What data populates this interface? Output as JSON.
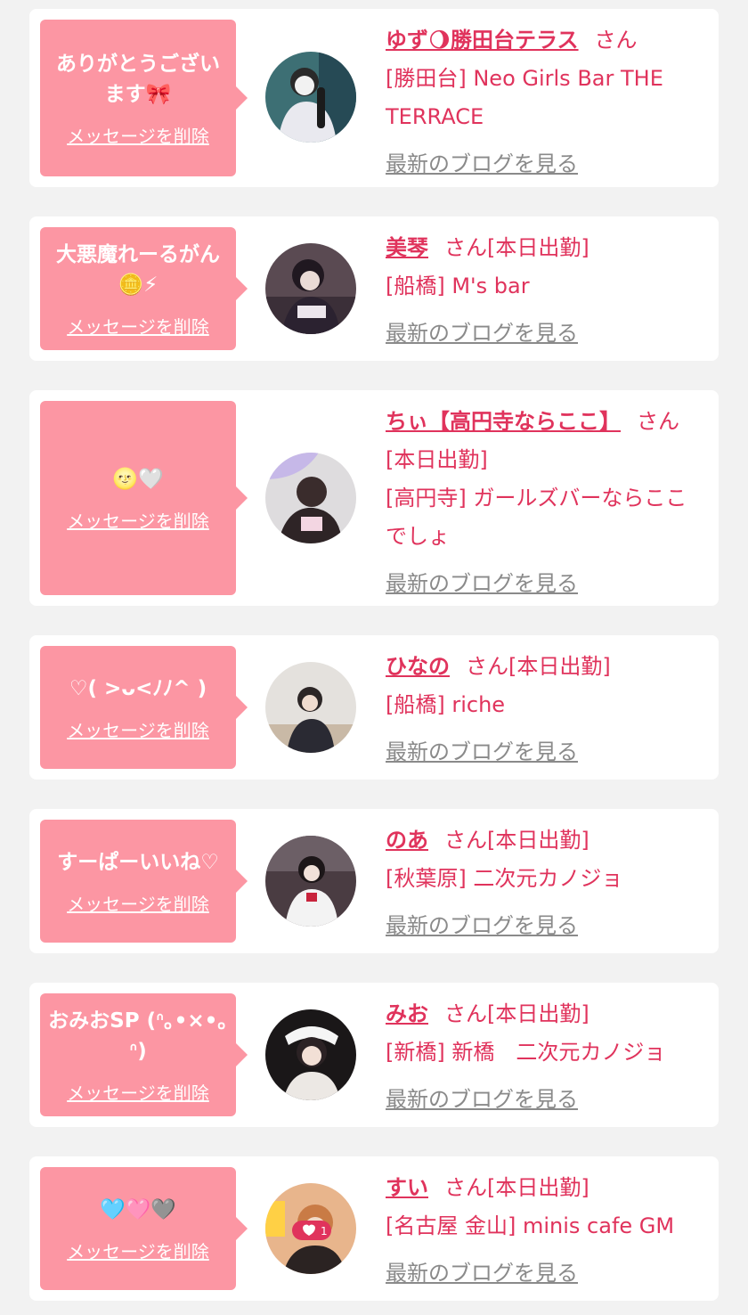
{
  "delete_label": "メッセージを削除",
  "blog_label": "最新のブログを見る",
  "san_suffix": "さん",
  "accent_color": "#e0335c",
  "bubble_color": "#fc96a3",
  "cards": [
    {
      "message": "ありがとうございます🎀",
      "name": "ゆず🌖勝田台テラス",
      "status": "",
      "shop": "[勝田台] Neo Girls Bar THE TERRACE"
    },
    {
      "message": "大悪魔れーるがん🪙⚡",
      "name": "美琴",
      "status": "[本日出勤]",
      "shop": "[船橋] M's bar"
    },
    {
      "message": "🌝🤍",
      "name": "ちぃ【高円寺ならここ】",
      "status": "[本日出勤]",
      "shop": "[高円寺] ガールズバーならここでしょ"
    },
    {
      "message": "♡( >ᴗ<ﾉﾉ^ )",
      "name": "ひなの",
      "status": "[本日出勤]",
      "shop": "[船橋] riche"
    },
    {
      "message": "すーぱーいいね♡",
      "name": "のあ",
      "status": "[本日出勤]",
      "shop": "[秋葉原] 二次元カノジョ"
    },
    {
      "message": "おみおSP (ᐢ｡•×•｡ᐢ)",
      "name": "みお",
      "status": "[本日出勤]",
      "shop": "[新橋] 新橋　二次元カノジョ"
    },
    {
      "message": "🩵🩷🩶",
      "name": "すい",
      "status": "[本日出勤]",
      "shop": "[名古屋 金山] minis cafe GM",
      "avatar_badge": "1"
    }
  ]
}
